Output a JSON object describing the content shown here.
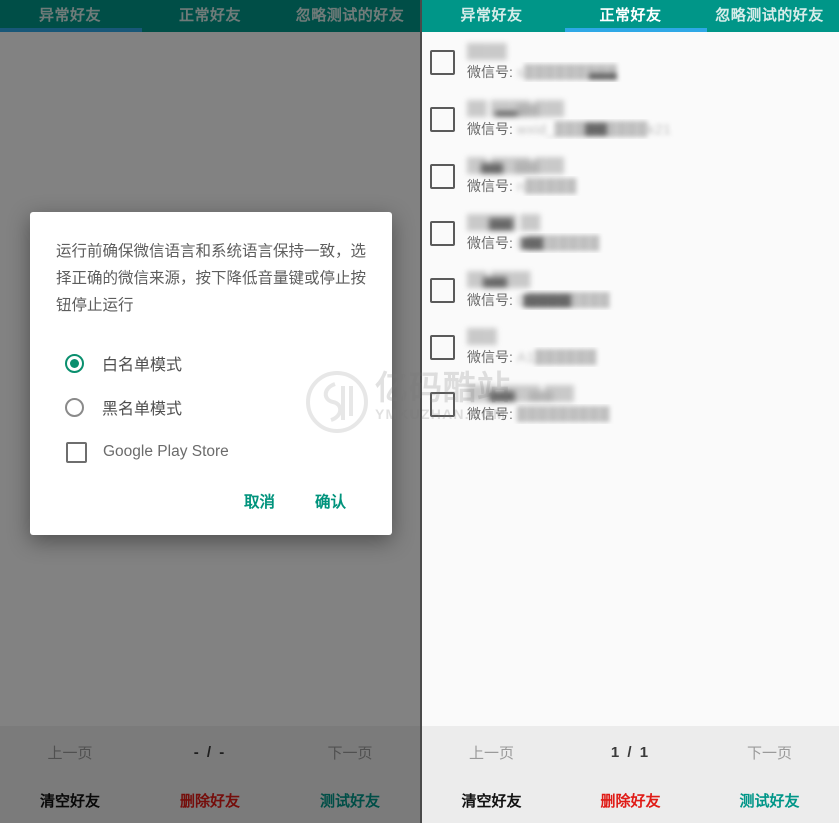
{
  "app": {
    "accent_teal": "#009688",
    "accent_blue": "#2ea8e6",
    "danger_red": "#e01b16",
    "scrim": "rgba(0,0,0,0.48)"
  },
  "left_panel": {
    "tabs": [
      {
        "label": "异常好友",
        "active": true
      },
      {
        "label": "正常好友",
        "active": false
      },
      {
        "label": "忽略测试的好友",
        "active": false
      }
    ],
    "pager": {
      "prev_label": "上一页",
      "count_label": "- / -",
      "next_label": "下一页"
    },
    "actions": {
      "clear_label": "清空好友",
      "delete_label": "删除好友",
      "test_label": "测试好友"
    },
    "dialog": {
      "message": "运行前确保微信语言和系统语言保持一致，选择正确的微信来源，按下降低音量键或停止按钮停止运行",
      "options": [
        {
          "label": "白名单模式",
          "selected": true
        },
        {
          "label": "黑名单模式",
          "selected": false
        }
      ],
      "checkbox": {
        "label": "Google Play Store",
        "checked": false
      },
      "cancel_label": "取消",
      "confirm_label": "确认"
    }
  },
  "right_panel": {
    "tabs": [
      {
        "label": "异常好友",
        "active": false
      },
      {
        "label": "正常好友",
        "active": true
      },
      {
        "label": "忽略测试的好友",
        "active": false
      }
    ],
    "list": {
      "wx_id_label": "微信号:",
      "items": [
        {
          "nick": "████",
          "wx_id": "s█████████",
          "checked": false
        },
        {
          "nick": "██ ████ ███",
          "wx_id": "wxid_█████████k21",
          "checked": false
        },
        {
          "nick": "██ ████ ███",
          "wx_id": "n█████",
          "checked": false
        },
        {
          "nick": "█████ ██",
          "wx_id": "D███████",
          "checked": false
        },
        {
          "nick": "██ ████",
          "wx_id": "D████████",
          "checked": false
        },
        {
          "nick": "███",
          "wx_id": "A1██████",
          "checked": false
        },
        {
          "nick": "███ ████ ███",
          "wx_id": "█████████",
          "checked": false
        }
      ]
    },
    "pager": {
      "prev_label": "上一页",
      "count_label": "1 / 1",
      "next_label": "下一页"
    },
    "actions": {
      "clear_label": "清空好友",
      "delete_label": "删除好友",
      "test_label": "测试好友"
    }
  },
  "watermark": {
    "cn_text": "亿码酷站",
    "en_text": "YMKUZHAN.COM"
  }
}
